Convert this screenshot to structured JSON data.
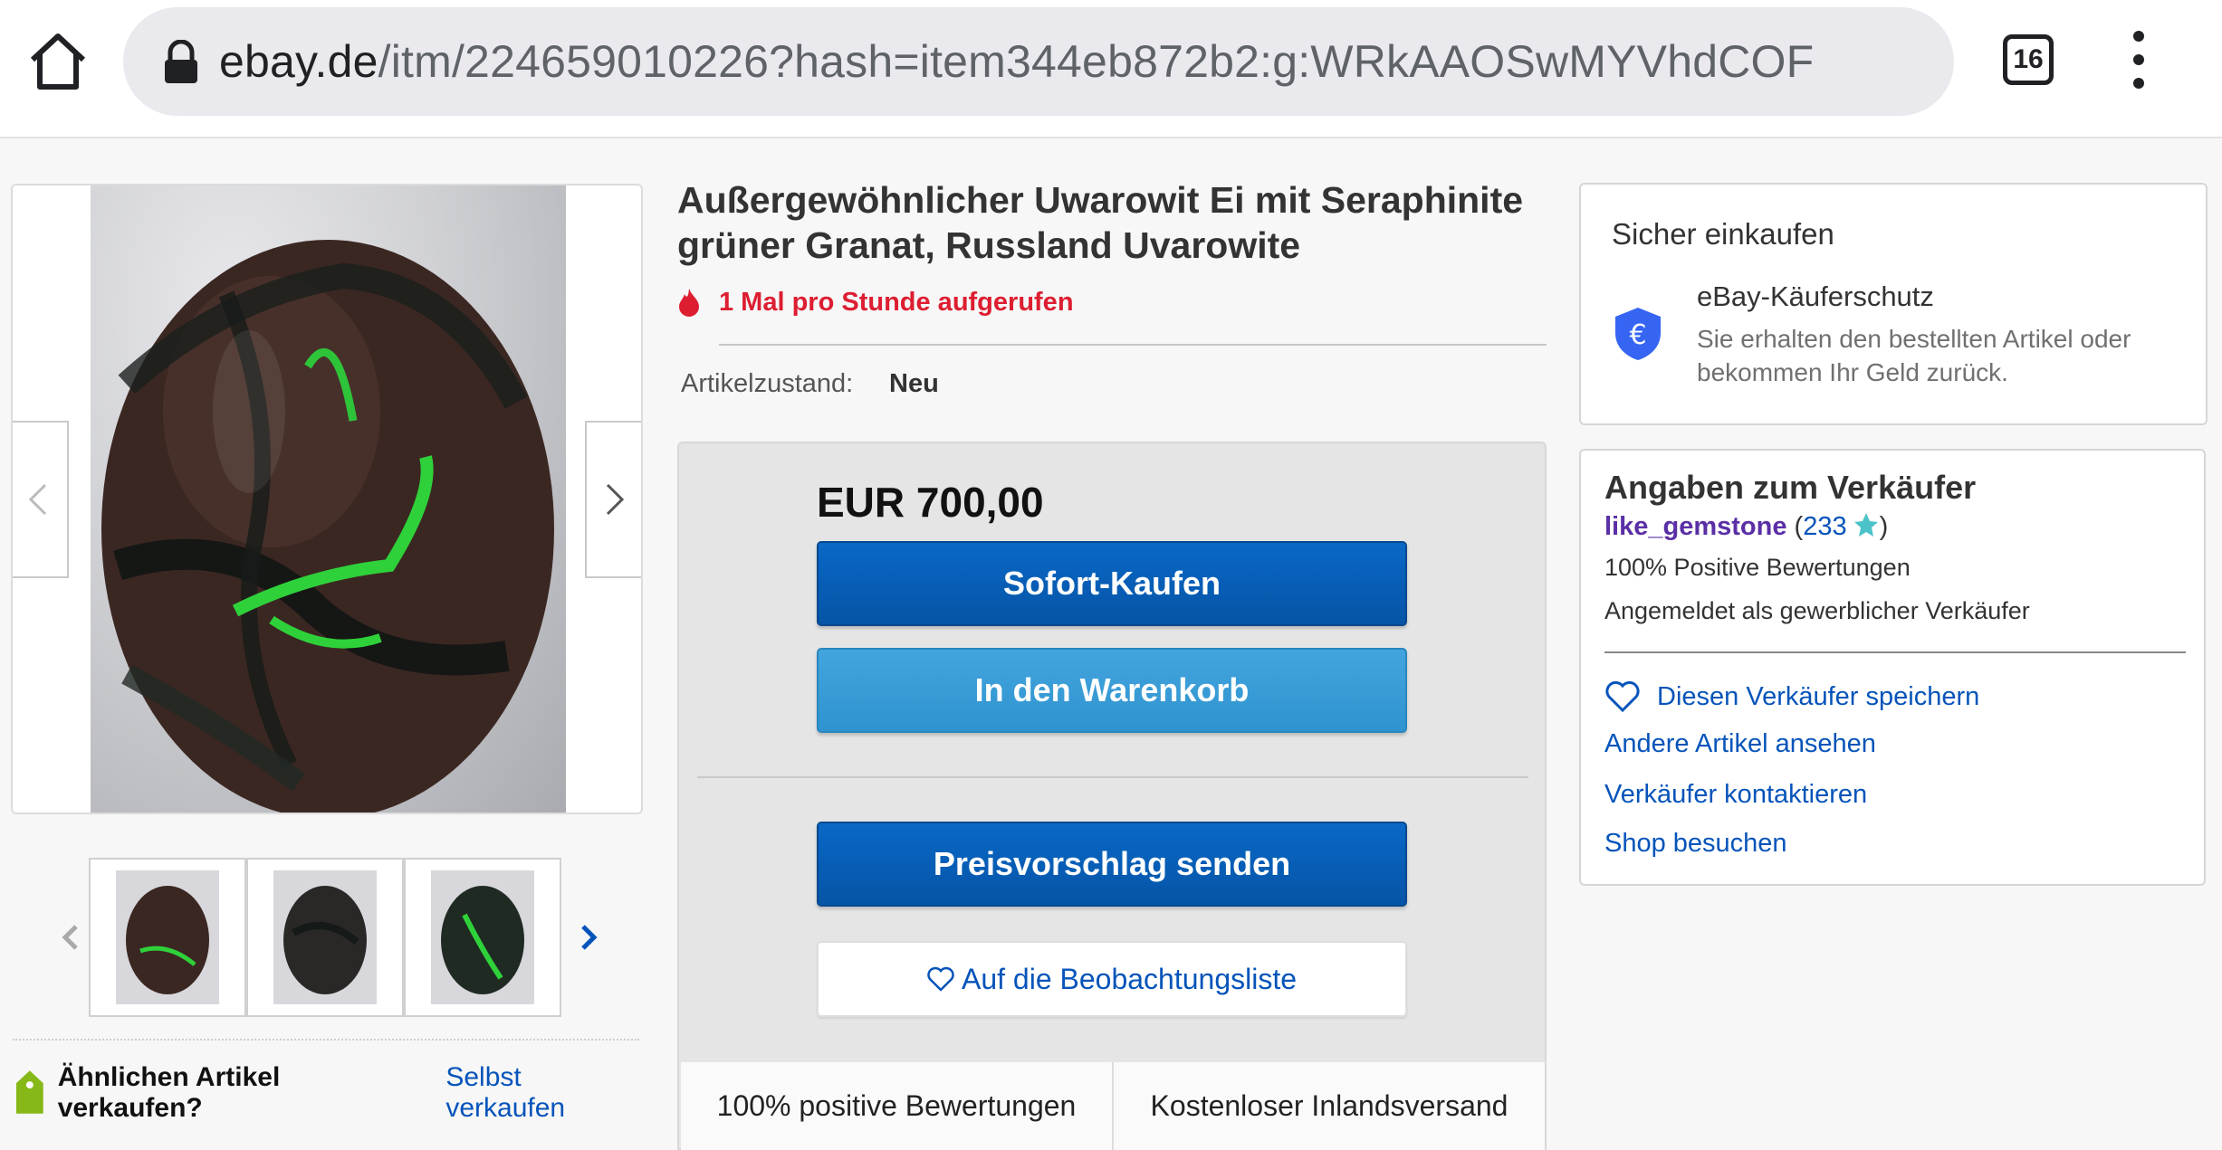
{
  "browser": {
    "url_host": "ebay.de",
    "url_path": "/itm/224659010226?hash=item344eb872b2:g:WRkAAOSwMYVhdCOF",
    "tab_count": "16"
  },
  "listing": {
    "title": "Außergewöhnlicher Uwarowit Ei mit Seraphinite grüner Granat, Russland Uvarowite",
    "views": "1 Mal pro Stunde aufgerufen",
    "condition_label": "Artikelzustand:",
    "condition_value": "Neu",
    "price": "EUR 700,00",
    "buy_now": "Sofort-Kaufen",
    "add_to_cart": "In den Warenkorb",
    "make_offer": "Preisvorschlag senden",
    "watchlist": "Auf die Beobachtungsliste",
    "badges": [
      "100% positive Bewertungen",
      "Kostenloser Inlandsversand"
    ]
  },
  "sell": {
    "question": "Ähnlichen Artikel verkaufen?",
    "link": "Selbst verkaufen"
  },
  "safe_shopping": {
    "heading": "Sicher einkaufen",
    "title": "eBay-Käuferschutz",
    "description": "Sie erhalten den bestellten Artikel oder bekommen Ihr Geld zurück."
  },
  "seller": {
    "heading": "Angaben zum Verkäufer",
    "name": "like_gemstone",
    "score": "233",
    "positive": "100% Positive Bewertungen",
    "business": "Angemeldet als gewerblicher Verkäufer",
    "save": "Diesen Verkäufer speichern",
    "other_items": "Andere Artikel ansehen",
    "contact": "Verkäufer kontaktieren",
    "shop": "Shop besuchen"
  },
  "colors": {
    "primary_button": "#0654ba",
    "secondary_button": "#3a9fd8",
    "link": "#0654ba",
    "alert_red": "#dd1e31",
    "seller_name": "#5a2fa6",
    "star": "#4cc3c9"
  },
  "icons": [
    "home-icon",
    "lock-icon",
    "tabs-icon",
    "more-vert-icon",
    "chevron-left-icon",
    "chevron-right-icon",
    "flame-icon",
    "heart-icon",
    "shield-euro-icon",
    "star-icon",
    "price-tag-icon"
  ]
}
